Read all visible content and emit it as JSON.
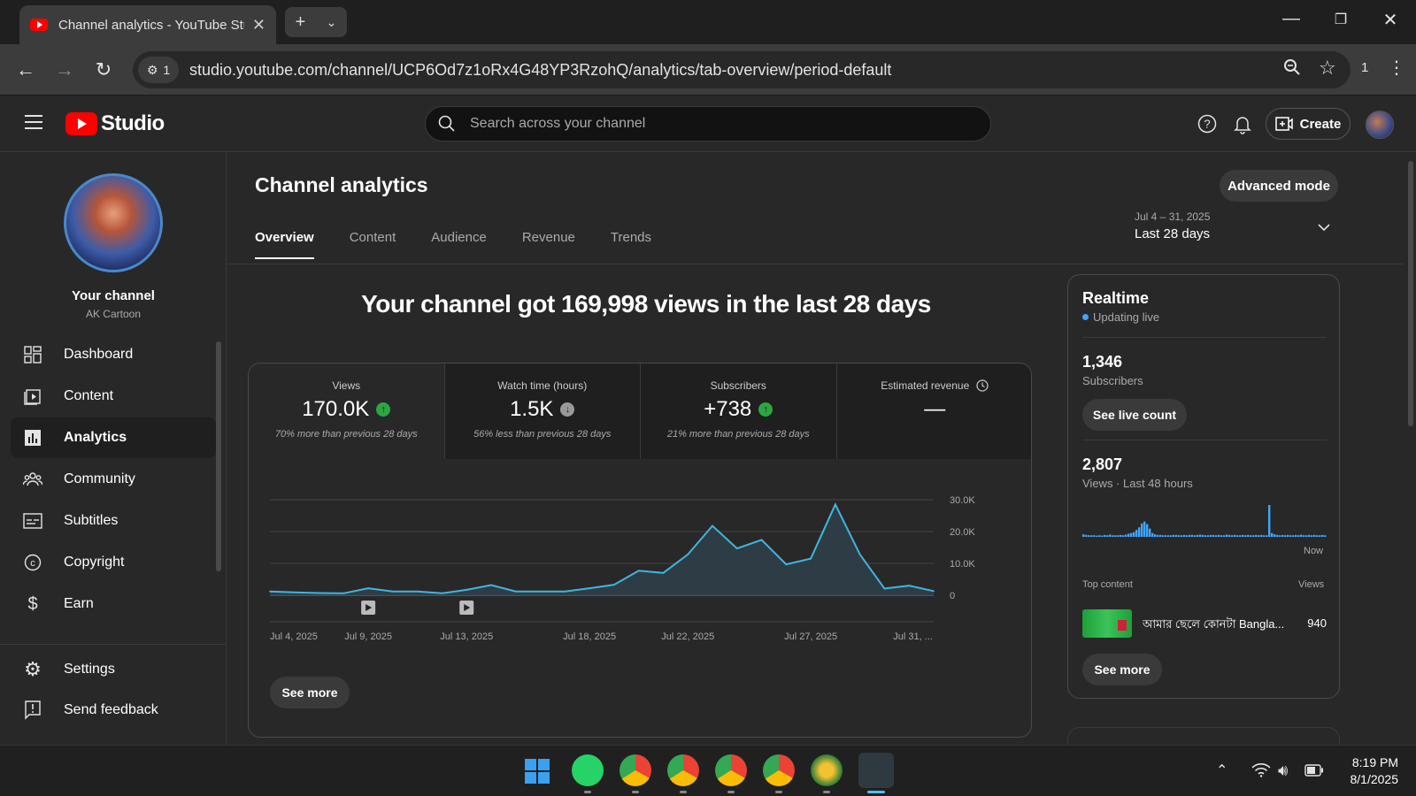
{
  "browser": {
    "tab_title": "Channel analytics - YouTube Studio",
    "url": "studio.youtube.com/channel/UCP6Od7z1oRx4G48YP3RzohQ/analytics/tab-overview/period-default",
    "site_info_count": "1",
    "extensions_count": "1"
  },
  "header": {
    "logo_text": "Studio",
    "search_placeholder": "Search across your channel",
    "create_label": "Create"
  },
  "sidebar": {
    "channel_name": "Your channel",
    "channel_handle": "AK Cartoon",
    "items": [
      {
        "label": "Dashboard",
        "icon": "dashboard-icon"
      },
      {
        "label": "Content",
        "icon": "content-icon"
      },
      {
        "label": "Analytics",
        "icon": "analytics-icon",
        "active": true
      },
      {
        "label": "Community",
        "icon": "community-icon"
      },
      {
        "label": "Subtitles",
        "icon": "subtitles-icon"
      },
      {
        "label": "Copyright",
        "icon": "copyright-icon"
      },
      {
        "label": "Earn",
        "icon": "earn-icon"
      }
    ],
    "bottom_items": [
      {
        "label": "Settings",
        "icon": "settings-icon"
      },
      {
        "label": "Send feedback",
        "icon": "feedback-icon"
      }
    ]
  },
  "main": {
    "title": "Channel analytics",
    "advanced_mode_label": "Advanced mode",
    "tabs": [
      "Overview",
      "Content",
      "Audience",
      "Revenue",
      "Trends"
    ],
    "active_tab": "Overview",
    "date_range_sub": "Jul 4 – 31, 2025",
    "date_range_main": "Last 28 days",
    "headline": "Your channel got 169,998 views in the last 28 days",
    "metrics": [
      {
        "label": "Views",
        "value": "170.0K",
        "trend": "up",
        "note": "70% more than previous 28 days"
      },
      {
        "label": "Watch time (hours)",
        "value": "1.5K",
        "trend": "down",
        "note": "56% less than previous 28 days"
      },
      {
        "label": "Subscribers",
        "value": "+738",
        "trend": "up",
        "note": "21% more than previous 28 days"
      },
      {
        "label": "Estimated revenue",
        "value": "—",
        "trend": "none",
        "note": ""
      }
    ],
    "see_more_label": "See more"
  },
  "chart_data": {
    "type": "area",
    "x": [
      "Jul 4",
      "Jul 5",
      "Jul 6",
      "Jul 7",
      "Jul 8",
      "Jul 9",
      "Jul 10",
      "Jul 11",
      "Jul 12",
      "Jul 13",
      "Jul 14",
      "Jul 15",
      "Jul 16",
      "Jul 17",
      "Jul 18",
      "Jul 19",
      "Jul 20",
      "Jul 21",
      "Jul 22",
      "Jul 23",
      "Jul 24",
      "Jul 25",
      "Jul 26",
      "Jul 27",
      "Jul 28",
      "Jul 29",
      "Jul 30",
      "Jul 31"
    ],
    "values": [
      1200,
      900,
      700,
      600,
      2200,
      1200,
      1200,
      600,
      1700,
      3200,
      1200,
      1200,
      1200,
      2200,
      3300,
      7700,
      7000,
      12800,
      21800,
      14700,
      17400,
      9700,
      11500,
      28500,
      12800,
      2100,
      3000,
      1300
    ],
    "x_tick_labels": [
      "Jul 4, 2025",
      "Jul 9, 2025",
      "Jul 13, 2025",
      "Jul 18, 2025",
      "Jul 22, 2025",
      "Jul 27, 2025",
      "Jul 31, ..."
    ],
    "x_tick_index": [
      0,
      4,
      8,
      13,
      17,
      22,
      26
    ],
    "y_ticks": [
      "30.0K",
      "20.0K",
      "10.0K",
      "0"
    ],
    "y_tick_values": [
      30000,
      20000,
      10000,
      0
    ],
    "ylim": [
      0,
      30000
    ],
    "grid": true,
    "video_markers_index": [
      4,
      8
    ],
    "line_color": "#41b4e0",
    "fill_color": "#2f3f48"
  },
  "realtime": {
    "title": "Realtime",
    "live_label": "Updating live",
    "subscribers_value": "1,346",
    "subscribers_label": "Subscribers",
    "see_live_label": "See live count",
    "views_value": "2,807",
    "views_label": "Views · Last 48 hours",
    "now_label": "Now",
    "bars": [
      0.08,
      0.06,
      0.05,
      0.05,
      0.05,
      0.04,
      0.05,
      0.04,
      0.06,
      0.05,
      0.07,
      0.05,
      0.05,
      0.05,
      0.06,
      0.05,
      0.07,
      0.1,
      0.12,
      0.15,
      0.22,
      0.3,
      0.42,
      0.48,
      0.4,
      0.26,
      0.12,
      0.08,
      0.06,
      0.06,
      0.05,
      0.05,
      0.05,
      0.05,
      0.06,
      0.06,
      0.05,
      0.05,
      0.06,
      0.05,
      0.06,
      0.06,
      0.05,
      0.06,
      0.07,
      0.06,
      0.05,
      0.05,
      0.06,
      0.06,
      0.05,
      0.06,
      0.05,
      0.05,
      0.07,
      0.06,
      0.05,
      0.06,
      0.05,
      0.05,
      0.06,
      0.05,
      0.06,
      0.05,
      0.05,
      0.06,
      0.05,
      0.06,
      0.05,
      0.05,
      1.0,
      0.12,
      0.08,
      0.06,
      0.05,
      0.06,
      0.05,
      0.06,
      0.05,
      0.05,
      0.06,
      0.05,
      0.07,
      0.05,
      0.05,
      0.06,
      0.05,
      0.06,
      0.05,
      0.05,
      0.06,
      0.05
    ],
    "top_content_label": "Top content",
    "views_col_label": "Views",
    "top_item_title": "আমার ছেলে কোনটা Bangla...",
    "top_item_views": "940",
    "see_more_label": "See more",
    "accent": "#3ea6ff"
  },
  "taskbar": {
    "time": "8:19 PM",
    "date": "8/1/2025"
  }
}
